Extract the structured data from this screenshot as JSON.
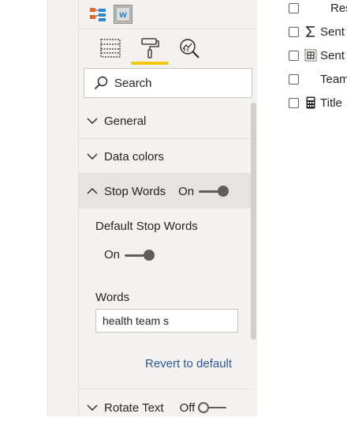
{
  "visual_icons": [
    {
      "name": "decomposition-tree-icon",
      "selected": false
    },
    {
      "name": "word-cloud-icon",
      "selected": true
    }
  ],
  "tabs": [
    {
      "name": "fields-tab",
      "icon": "table-icon"
    },
    {
      "name": "format-tab",
      "icon": "paint-roller-icon",
      "active": true
    },
    {
      "name": "analytics-tab",
      "icon": "magnifier-chart-icon"
    }
  ],
  "search": {
    "placeholder": "Search"
  },
  "sections": {
    "general": {
      "label": "General"
    },
    "data_colors": {
      "label": "Data colors"
    },
    "stop_words": {
      "label": "Stop Words",
      "toggle_text": "On",
      "expanded": true
    },
    "rotate_text": {
      "label": "Rotate Text",
      "toggle_text": "Off"
    }
  },
  "stop_words_panel": {
    "default_label": "Default Stop Words",
    "default_toggle_text": "On",
    "words_label": "Words",
    "words_value": "health team s",
    "revert_label": "Revert to default"
  },
  "fields": [
    {
      "label": "Resp",
      "icon": ""
    },
    {
      "label": "Sent",
      "icon": "sigma-icon"
    },
    {
      "label": "Sent",
      "icon": "grid-icon"
    },
    {
      "label": "Team",
      "icon": ""
    },
    {
      "label": "Title",
      "icon": "calculator-icon"
    }
  ],
  "colors": {
    "accent": "#f2c811",
    "link": "#2b5797"
  }
}
